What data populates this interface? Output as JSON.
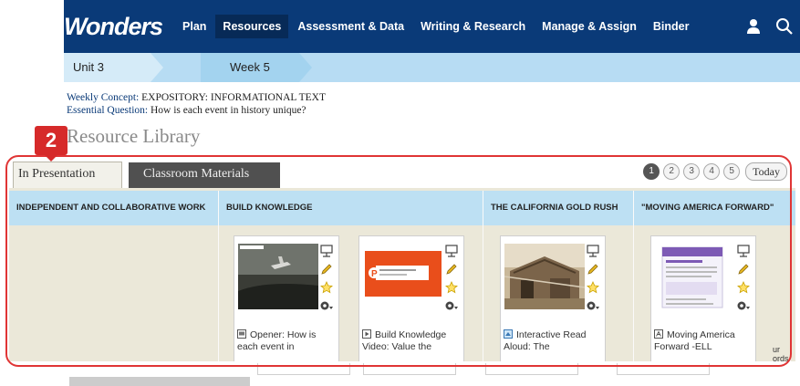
{
  "nav": {
    "logo": "Wonders",
    "items": [
      "Plan",
      "Resources",
      "Assessment & Data",
      "Writing & Research",
      "Manage & Assign",
      "Binder"
    ],
    "active_index": 1
  },
  "breadcrumb": {
    "unit": "Unit 3",
    "week": "Week 5"
  },
  "concept": {
    "weekly_label": "Weekly Concept:",
    "weekly_value": " EXPOSITORY: INFORMATIONAL TEXT",
    "question_label": "Essential Question:",
    "question_value": " How is each event in history unique?"
  },
  "resource_library_title": "Resource Library",
  "callout_number": "2",
  "tabs": {
    "presentation": "In Presentation",
    "classroom": "Classroom Materials"
  },
  "pager": {
    "pages": [
      "1",
      "2",
      "3",
      "4",
      "5"
    ],
    "active": "1",
    "today": "Today"
  },
  "columns": [
    "INDEPENDENT AND COLLABORATIVE WORK",
    "BUILD KNOWLEDGE",
    "THE CALIFORNIA GOLD RUSH",
    "\"MOVING AMERICA FORWARD\""
  ],
  "cards": [
    {
      "title_line1": "Opener: How is",
      "title_line2": "each event in"
    },
    {
      "title_line1": "Build Knowledge",
      "title_line2": "Video: Value the"
    },
    {
      "title_line1": "Interactive Read",
      "title_line2": "Aloud: The"
    },
    {
      "title_line1": "Moving America",
      "title_line2": "Forward -ELL"
    }
  ],
  "edge_text": {
    "line1": "ur",
    "line2": "ords"
  },
  "colors": {
    "nav": "#0a3a78",
    "accent_red": "#e03535",
    "header_blue": "#bde0f3"
  }
}
